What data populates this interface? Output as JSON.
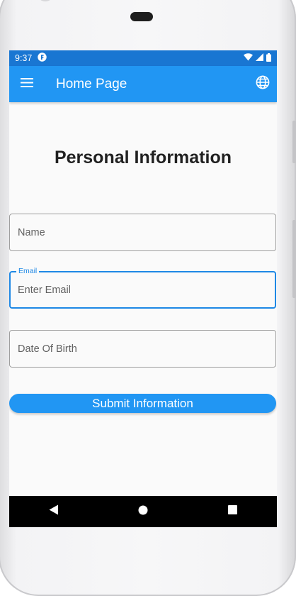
{
  "status_bar": {
    "time": "9:37",
    "left_icon": "notification-f-icon",
    "right_icons": [
      "wifi-icon",
      "signal-icon",
      "battery-icon"
    ]
  },
  "app_bar": {
    "title": "Home Page",
    "menu_icon": "menu-icon",
    "action_icon": "globe-icon"
  },
  "page": {
    "heading": "Personal Information"
  },
  "form": {
    "name": {
      "placeholder": "Name",
      "value": ""
    },
    "email": {
      "label": "Email",
      "placeholder": "Enter Email",
      "value": "",
      "focused": true
    },
    "dob": {
      "placeholder": "Date Of Birth",
      "value": ""
    },
    "submit_label": "Submit Information"
  },
  "nav_bar": {
    "items": [
      "back-icon",
      "home-icon",
      "recents-icon"
    ]
  },
  "colors": {
    "primary": "#2196f3",
    "status_bar": "#1976d2",
    "focus": "#1e88e5",
    "background": "#fafafa",
    "nav_bar": "#000000"
  }
}
